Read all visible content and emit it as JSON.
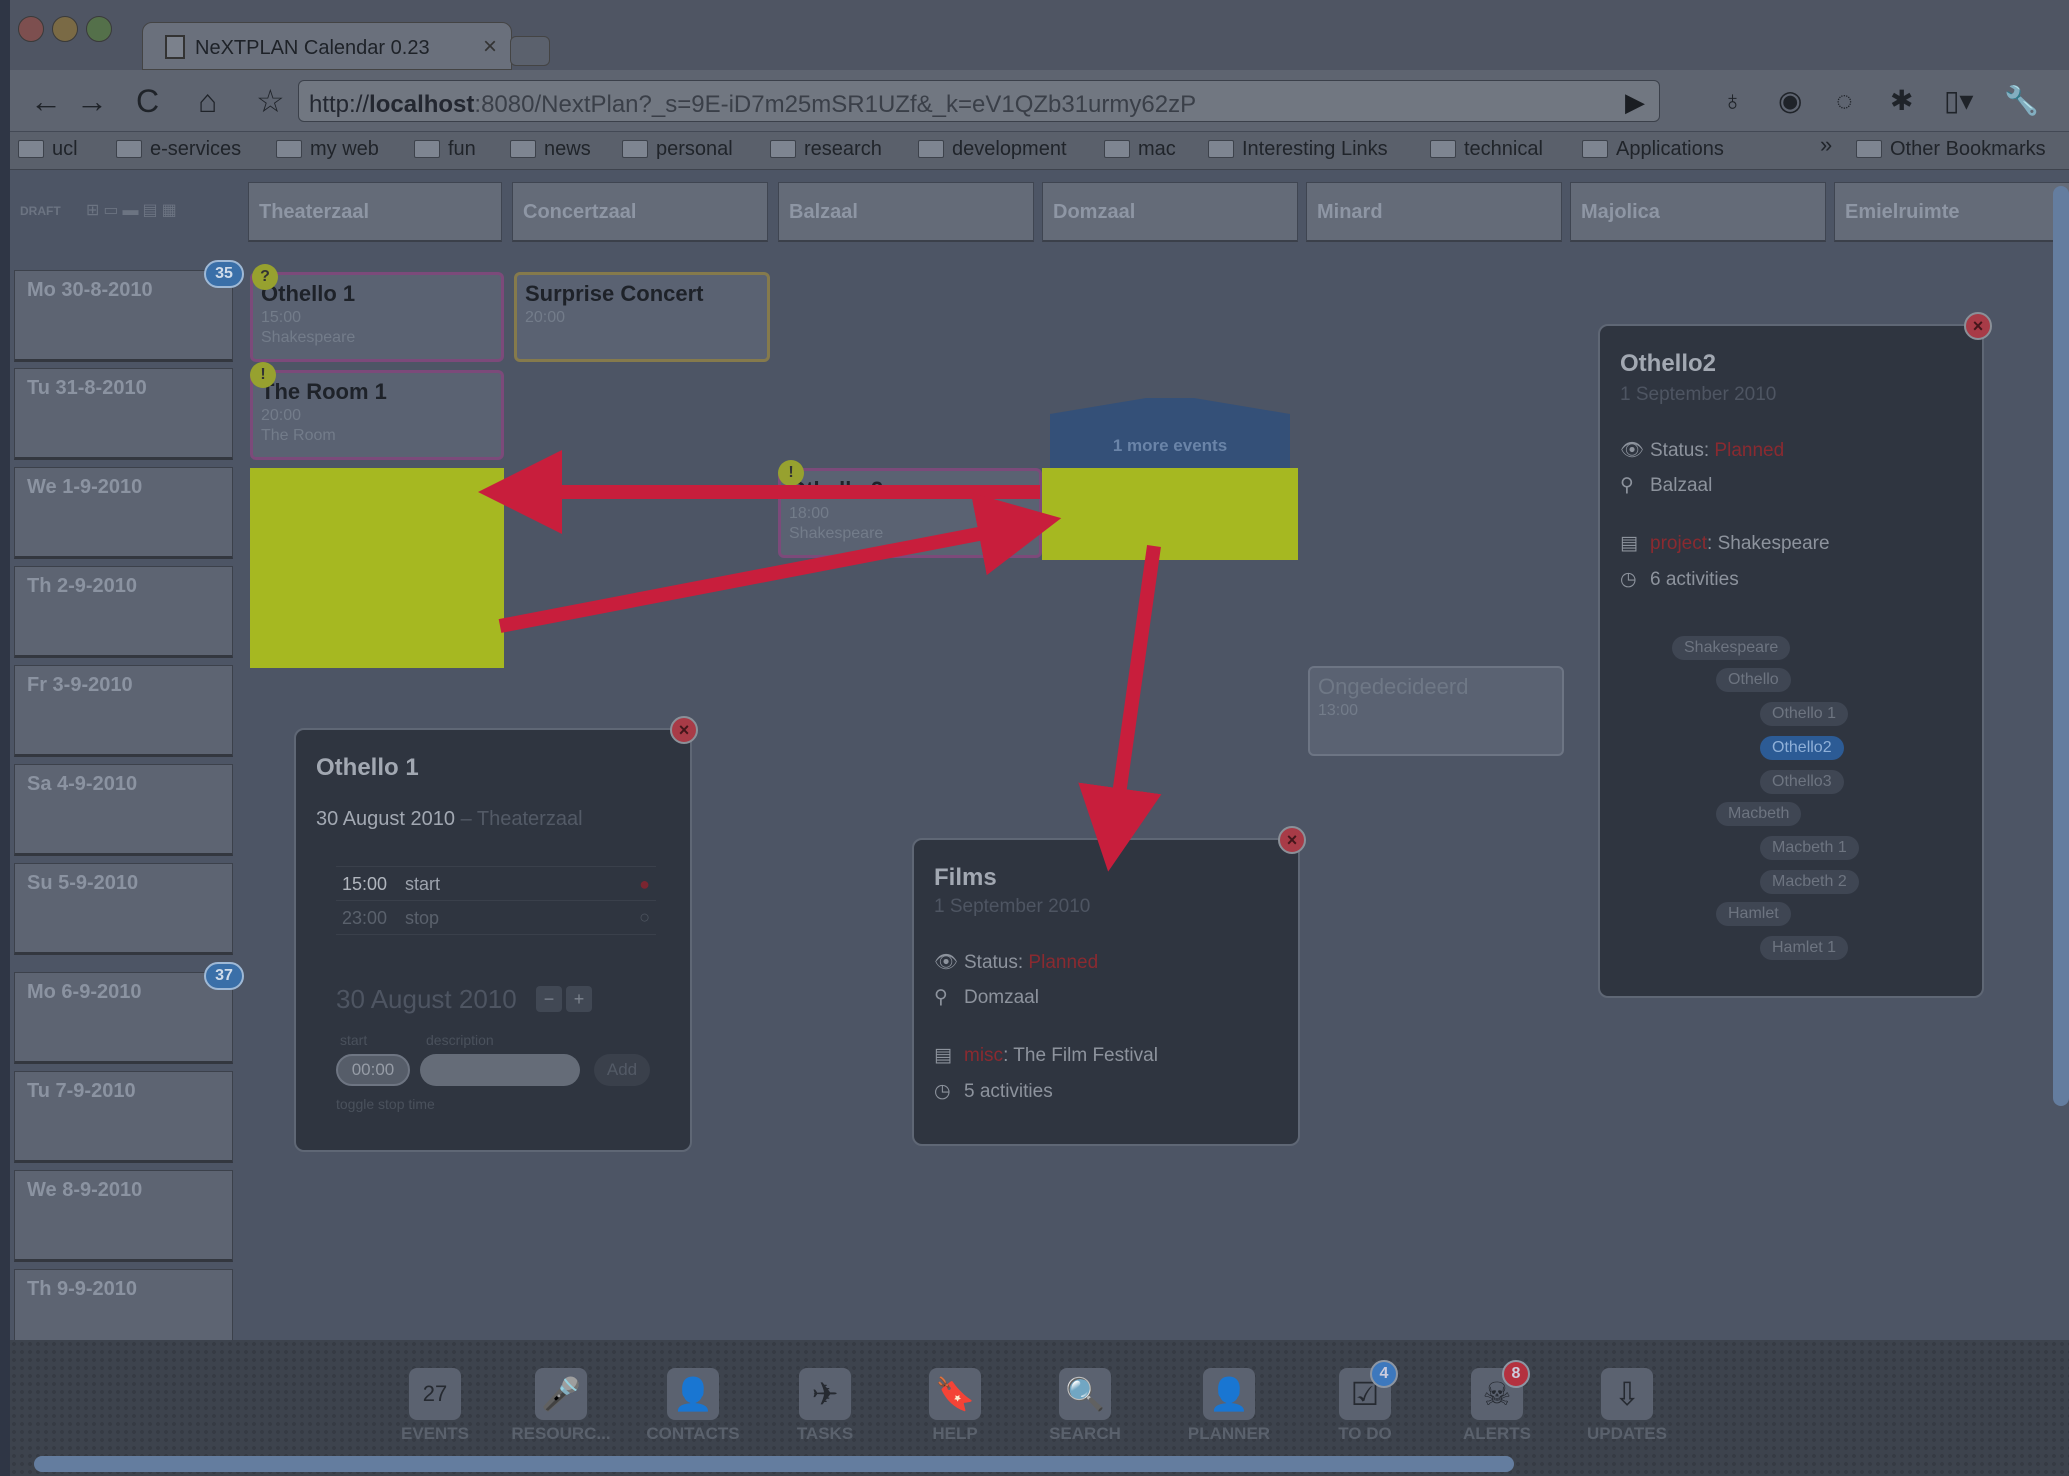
{
  "browser": {
    "tab_title": "NeXTPLAN Calendar 0.23",
    "url_prefix": "http://",
    "url_host": "localhost",
    "url_rest": ":8080/NextPlan?_s=9E-iD7m25mSR1UZf&_k=eV1QZb31urmy62zP",
    "bookmarks": [
      "ucl",
      "e-services",
      "my web",
      "fun",
      "news",
      "personal",
      "research",
      "development",
      "mac",
      "Interesting Links",
      "technical",
      "Applications"
    ],
    "other_bookmarks": "Other Bookmarks",
    "overflow": "»"
  },
  "calendar": {
    "toolbar_label": "DRAFT",
    "rooms": [
      "Theaterzaal",
      "Concertzaal",
      "Balzaal",
      "Domzaal",
      "Minard",
      "Majolica",
      "Emielruimte"
    ],
    "days": [
      "Mo  30-8-2010",
      "Tu  31-8-2010",
      "We  1-9-2010",
      "Th  2-9-2010",
      "Fr  3-9-2010",
      "Sa  4-9-2010",
      "Su  5-9-2010",
      "Mo  6-9-2010",
      "Tu  7-9-2010",
      "We  8-9-2010",
      "Th  9-9-2010"
    ],
    "week_badges": [
      "35",
      "37"
    ],
    "events": {
      "othello1": {
        "title": "Othello 1",
        "time": "15:00",
        "sub": "Shakespeare",
        "mark": "?"
      },
      "surprise": {
        "title": "Surprise Concert",
        "time": "20:00"
      },
      "room1": {
        "title": "The Room 1",
        "time": "20:00",
        "sub": "The Room",
        "mark": "!"
      },
      "othello_bal": {
        "title": "Othello 2",
        "time": "18:00",
        "sub": "Shakespeare",
        "mark": "!"
      },
      "more": {
        "label": "1 more events"
      },
      "ongedecideerd": {
        "title": "Ongedecideerd",
        "time": "13:00"
      }
    }
  },
  "popup_othello1": {
    "title": "Othello 1",
    "date": "30 August 2010",
    "room": " – Theaterzaal",
    "rows": [
      {
        "time": "15:00",
        "label": "start"
      },
      {
        "time": "23:00",
        "label": "stop"
      }
    ],
    "new_date": "30 August 2010",
    "start_label": "start",
    "desc_label": "description",
    "start_value": "00:00",
    "add_label": "Add",
    "toggle_label": "toggle stop time"
  },
  "popup_films": {
    "title": "Films",
    "date": "1 September 2010",
    "status_label": "Status: ",
    "status_value": "Planned",
    "room": "Domzaal",
    "project_label": "misc",
    "project_value": ": The Film Festival",
    "activities": "5 activities"
  },
  "popup_othello2": {
    "title": "Othello2",
    "date": "1 September 2010",
    "status_label": "Status: ",
    "status_value": "Planned",
    "room": "Balzaal",
    "project_label": "project",
    "project_value": ": Shakespeare",
    "activities": "6 activities",
    "tree": [
      "Shakespeare",
      "Othello",
      "Othello 1",
      "Othello2",
      "Othello3",
      "Macbeth",
      "Macbeth 1",
      "Macbeth 2",
      "Hamlet",
      "Hamlet 1"
    ]
  },
  "dock": [
    {
      "label": "EVENTS",
      "icon": "27"
    },
    {
      "label": "RESOURC...",
      "icon": "🎤"
    },
    {
      "label": "CONTACTS",
      "icon": "👤"
    },
    {
      "label": "TASKS",
      "icon": "✈"
    },
    {
      "label": "HELP",
      "icon": "🔖"
    },
    {
      "label": "SEARCH",
      "icon": "🔍"
    },
    {
      "label": "PLANNER",
      "icon": "👤"
    },
    {
      "label": "TO DO",
      "icon": "☑",
      "badge": "4",
      "badge_color": "#3d78bd"
    },
    {
      "label": "ALERTS",
      "icon": "☠",
      "badge": "8",
      "badge_color": "#b4313f"
    },
    {
      "label": "UPDATES",
      "icon": "⇩"
    }
  ],
  "colors": {
    "highlight": "#a6b821",
    "arrow": "#c81e3c",
    "planned": "#8a2a30"
  }
}
